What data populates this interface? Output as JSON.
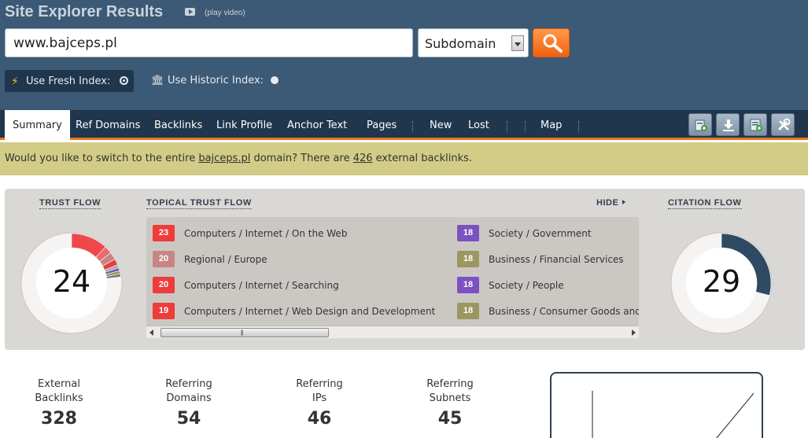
{
  "header": {
    "title": "Site Explorer Results",
    "video_label": "(play video)",
    "url_value": "www.bajceps.pl",
    "scope_value": "Subdomain",
    "fresh_index_label": "Use Fresh Index:",
    "historic_index_label": "Use Historic Index:"
  },
  "nav": {
    "tabs": [
      "Summary",
      "Ref Domains",
      "Backlinks",
      "Link Profile",
      "Anchor Text",
      "Pages",
      "New",
      "Lost",
      "Map"
    ]
  },
  "notice": {
    "part1": "Would you like to switch to the entire ",
    "domain": "bajceps.pl",
    "part2": " domain? There are ",
    "count": "426",
    "part3": " external backlinks."
  },
  "flows": {
    "trust_flow_title": "TRUST FLOW",
    "trust_flow_value": 24,
    "topical_title": "TOPICAL TRUST FLOW",
    "hide_label": "HIDE",
    "citation_flow_title": "CITATION FLOW",
    "citation_flow_value": 29,
    "topical": [
      {
        "score": "23",
        "label": "Computers / Internet / On the Web",
        "color": "#ee3b3b"
      },
      {
        "score": "20",
        "label": "Regional / Europe",
        "color": "#c98585"
      },
      {
        "score": "20",
        "label": "Computers / Internet / Searching",
        "color": "#ee3b3b"
      },
      {
        "score": "19",
        "label": "Computers / Internet / Web Design and Development",
        "color": "#ee3b3b"
      },
      {
        "score": "18",
        "label": "Society / Government",
        "color": "#7b52c0"
      },
      {
        "score": "18",
        "label": "Business / Financial Services",
        "color": "#9c9660"
      },
      {
        "score": "18",
        "label": "Society / People",
        "color": "#7b52c0"
      },
      {
        "score": "18",
        "label": "Business / Consumer Goods and",
        "color": "#9c9660"
      }
    ],
    "trust_segments": [
      {
        "share": 0.12,
        "color": "#f0474b"
      },
      {
        "share": 0.025,
        "color": "#e86a6a"
      },
      {
        "share": 0.025,
        "color": "#c98585"
      },
      {
        "share": 0.02,
        "color": "#e14040"
      },
      {
        "share": 0.01,
        "color": "#a8a8a8"
      },
      {
        "share": 0.01,
        "color": "#7b52c0"
      },
      {
        "share": 0.01,
        "color": "#9c9660"
      },
      {
        "share": 0.01,
        "color": "#7b7b7b"
      }
    ],
    "citation_share": 0.29,
    "citation_color": "#2f4a63"
  },
  "stats": [
    {
      "label_1": "External",
      "label_2": "Backlinks",
      "value": "328"
    },
    {
      "label_1": "Referring",
      "label_2": "Domains",
      "value": "54"
    },
    {
      "label_1": "Referring",
      "label_2": "IPs",
      "value": "46"
    },
    {
      "label_1": "Referring",
      "label_2": "Subnets",
      "value": "45"
    }
  ]
}
